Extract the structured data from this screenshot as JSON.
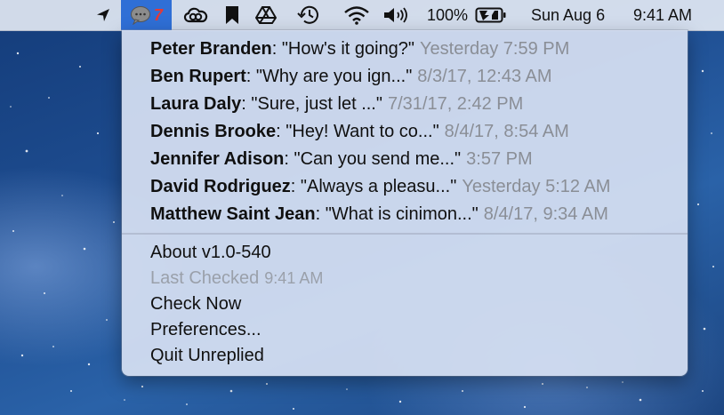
{
  "menubar": {
    "unread_count": "7",
    "battery_percent": "100%",
    "date": "Sun Aug 6",
    "time": "9:41 AM",
    "icons": [
      "location-arrow-icon",
      "chat-bubble-icon",
      "creative-cloud-icon",
      "bookmark-icon",
      "google-drive-icon",
      "time-machine-icon",
      "wifi-icon",
      "volume-icon",
      "battery-charging-icon"
    ],
    "accent_color": "#2f6fd6",
    "badge_color": "#e53935"
  },
  "messages": [
    {
      "sender": "Peter Branden",
      "text": ": \"How's it going?\"",
      "time": "Yesterday 7:59 PM"
    },
    {
      "sender": "Ben Rupert",
      "text": ": \"Why are you ign...\"",
      "time": "8/3/17, 12:43 AM"
    },
    {
      "sender": "Laura Daly",
      "text": ": \"Sure, just let ...\"",
      "time": "7/31/17, 2:42 PM"
    },
    {
      "sender": "Dennis Brooke",
      "text": ": \"Hey! Want to co...\"",
      "time": "8/4/17, 8:54 AM"
    },
    {
      "sender": "Jennifer Adison",
      "text": ": \"Can you send me...\"",
      "time": "3:57 PM"
    },
    {
      "sender": "David Rodriguez",
      "text": ": \"Always a pleasu...\"",
      "time": "Yesterday 5:12 AM"
    },
    {
      "sender": "Matthew Saint Jean",
      "text": ": \"What is cinimon...\"",
      "time": "8/4/17, 9:34 AM"
    }
  ],
  "actions": {
    "about": "About v1.0-540",
    "last_checked_label": "Last Checked",
    "last_checked_value": "9:41 AM",
    "check_now": "Check Now",
    "preferences": "Preferences...",
    "quit": "Quit Unreplied"
  }
}
